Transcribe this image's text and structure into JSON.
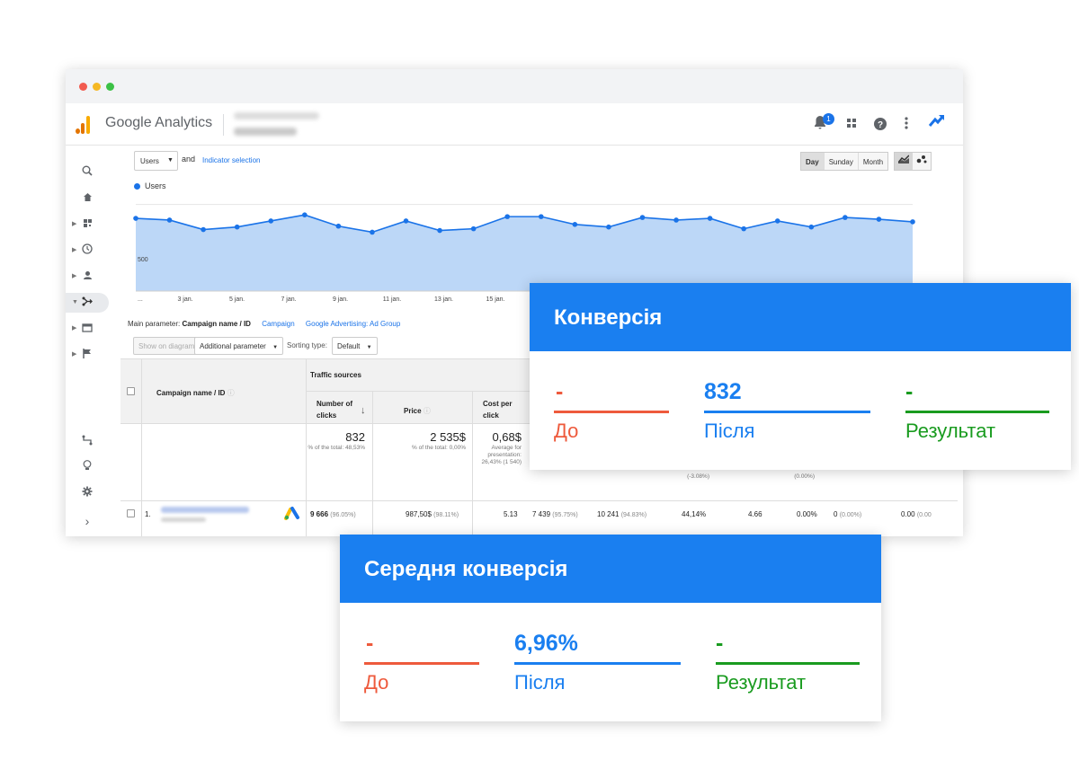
{
  "app": {
    "title": "Google Analytics",
    "notification_count": "1"
  },
  "toolbar": {
    "metric": "Users",
    "and": "and",
    "indicator_link": "Indicator selection",
    "periods": [
      "Day",
      "Sunday",
      "Month"
    ],
    "active_period": "Day"
  },
  "chart_data": {
    "type": "line",
    "series": [
      {
        "name": "Users",
        "values": [
          840,
          820,
          710,
          740,
          810,
          880,
          750,
          680,
          810,
          700,
          720,
          860,
          860,
          770,
          740,
          850,
          820,
          840,
          720,
          810,
          740,
          850,
          830,
          800
        ]
      }
    ],
    "y_ticks": [
      "1 000",
      "500"
    ],
    "x_ticks": [
      "...",
      "3 jan.",
      "5 jan.",
      "7 jan.",
      "9 jan.",
      "11 jan.",
      "13 jan.",
      "15 jan."
    ],
    "ylim": [
      0,
      1100
    ],
    "color": "#1a73e8"
  },
  "main_param": {
    "label": "Main parameter:",
    "active": "Campaign name / ID",
    "links": [
      "Campaign",
      "Google Advertising: Ad Group"
    ]
  },
  "table_tools": {
    "show_on_diagram": "Show on diagram",
    "additional_parameter": "Additional parameter",
    "sorting_label": "Sorting type:",
    "sorting_value": "Default"
  },
  "table": {
    "col_campaign": "Campaign name / ID",
    "group_header": "Traffic sources",
    "col_clicks": "Number of clicks",
    "col_price": "Price",
    "col_cpc": "Cost per click",
    "totals": {
      "clicks": "832",
      "clicks_sub": "% of the total: 48,53%",
      "price": "2 535$",
      "price_sub": "% of the total: 0,00%",
      "cpc": "0,68$",
      "cpc_sub": "Average for presentation: 26,43% (1 540)",
      "partial_1": "(-3.08%)",
      "partial_2": "(0.00%)"
    },
    "row1": {
      "index": "1.",
      "clicks": "9 666",
      "clicks_pct": "(96.05%)",
      "price": "987,50$",
      "price_pct": "(98.11%)",
      "cpc": "5.13",
      "c4": "7 439",
      "c4_pct": "(95.75%)",
      "c5": "10 241",
      "c5_pct": "(94.83%)",
      "c6": "44,14%",
      "c7": "4.66",
      "c8": "0.00%",
      "c9": "0",
      "c9_pct": "(0.00%)",
      "c10": "0.00",
      "c10_pct": "(0.00"
    }
  },
  "cards": {
    "conversion": {
      "title": "Конверсія",
      "before_value": "-",
      "before_label": "До",
      "after_value": "832",
      "after_label": "Після",
      "result_value": "-",
      "result_label": "Результат"
    },
    "avg_conversion": {
      "title": "Середня конверсія",
      "before_value": "-",
      "before_label": "До",
      "after_value": "6,96%",
      "after_label": "Після",
      "result_value": "-",
      "result_label": "Результат"
    }
  },
  "colors": {
    "before": "#ee5a3c",
    "after": "#1a7ff0",
    "result": "#199b1f",
    "header": "#1a7ff0"
  }
}
